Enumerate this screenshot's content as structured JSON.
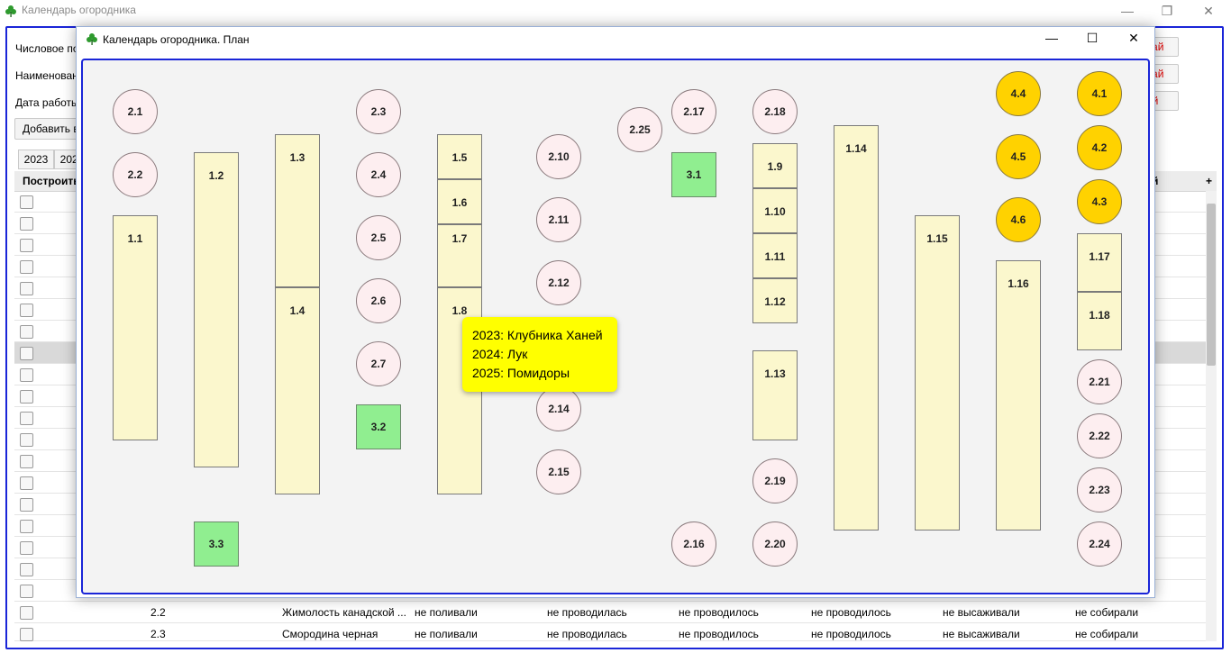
{
  "main_window": {
    "title": "Календарь огородника",
    "controls": {
      "minimize": "—",
      "maximize": "❐",
      "close": "✕"
    },
    "form": {
      "label_numeric": "Числовое по",
      "label_name": "Наименован",
      "label_date": "Дата работы",
      "button_add": "Добавить в",
      "right_buttons": [
        "кай",
        "кай",
        "й"
      ]
    },
    "year_tabs": [
      "2023",
      "2023"
    ],
    "table": {
      "header_first": "Построить",
      "header_last": "й",
      "header_plus": "+",
      "bottom_rows": [
        {
          "code": "2.2",
          "name": "Жимолость канадской ...",
          "c1": "не поливали",
          "c2": "не проводилась",
          "c3": "не проводилось",
          "c4": "не проводилось",
          "c5": "не высаживали",
          "c6": "не собирали"
        },
        {
          "code": "2.3",
          "name": "Смородина черная",
          "c1": "не поливали",
          "c2": "не проводилась",
          "c3": "не проводилось",
          "c4": "не проводилось",
          "c5": "не высаживали",
          "c6": "не собирали"
        }
      ]
    }
  },
  "plan_window": {
    "title": "Календарь огородника. План",
    "controls": {
      "minimize": "—",
      "maximize": "☐",
      "close": "✕"
    },
    "beds": [
      "1.1",
      "1.2",
      "1.3",
      "1.4",
      "1.5",
      "1.6",
      "1.7",
      "1.8",
      "1.9",
      "1.10",
      "1.11",
      "1.12",
      "1.13",
      "1.14",
      "1.15",
      "1.16",
      "1.17",
      "1.18"
    ],
    "circles": [
      "2.1",
      "2.2",
      "2.3",
      "2.4",
      "2.5",
      "2.6",
      "2.7",
      "2.10",
      "2.11",
      "2.12",
      "2.14",
      "2.15",
      "2.16",
      "2.17",
      "2.18",
      "2.19",
      "2.20",
      "2.21",
      "2.22",
      "2.23",
      "2.24",
      "2.25"
    ],
    "squares": [
      "3.1",
      "3.2",
      "3.3"
    ],
    "gold_circles": [
      "4.1",
      "4.2",
      "4.3",
      "4.4",
      "4.5",
      "4.6"
    ],
    "tooltip": [
      "2023: Клубника Ханей",
      "2024: Лук",
      "2025: Помидоры"
    ],
    "colors": {
      "bed": "#fbf7cd",
      "circle": "#fdeef0",
      "square": "#90ee90",
      "gold": "#ffd200",
      "tooltip": "#ffff00",
      "frame": "#1a25d8"
    }
  }
}
